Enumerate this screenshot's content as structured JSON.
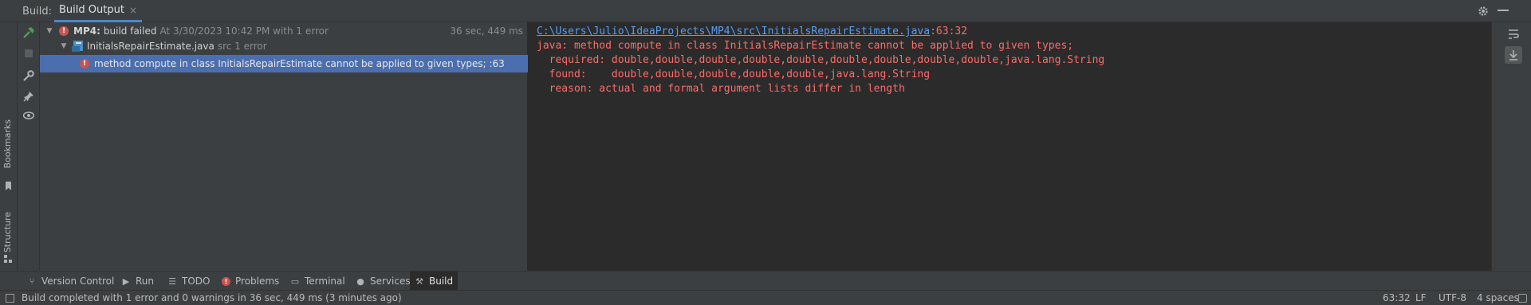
{
  "header": {
    "build_label": "Build:",
    "tab_label": "Build Output",
    "tab_close": "×"
  },
  "left_stripe": {
    "bookmarks": "Bookmarks",
    "structure": "Structure"
  },
  "tree": {
    "root": {
      "project": "MP4:",
      "status": "build failed",
      "detail": "At 3/30/2023 10:42 PM with 1 error",
      "time": "36 sec, 449 ms"
    },
    "file": {
      "name": "InitialsRepairEstimate.java",
      "detail": "src 1 error"
    },
    "error": {
      "message": "method compute in class InitialsRepairEstimate cannot be applied to given types; :63"
    }
  },
  "console": {
    "path": "C:\\Users\\Julio\\IdeaProjects\\MP4\\src\\InitialsRepairEstimate.java",
    "position": ":63:32",
    "line1": "java: method compute in class InitialsRepairEstimate cannot be applied to given types;",
    "line2": "  required: double,double,double,double,double,double,double,double,double,java.lang.String",
    "line3": "  found:    double,double,double,double,double,java.lang.String",
    "line4": "  reason: actual and formal argument lists differ in length"
  },
  "bottom_tabs": [
    {
      "label": "Version Control",
      "icon": "branch-icon"
    },
    {
      "label": "Run",
      "icon": "play-icon"
    },
    {
      "label": "TODO",
      "icon": "list-icon"
    },
    {
      "label": "Problems",
      "icon": "error-icon"
    },
    {
      "label": "Terminal",
      "icon": "terminal-icon"
    },
    {
      "label": "Services",
      "icon": "services-icon"
    },
    {
      "label": "Build",
      "icon": "hammer-icon"
    }
  ],
  "status_bar": {
    "message": "Build completed with 1 error and 0 warnings in 36 sec, 449 ms (3 minutes ago)",
    "position": "63:32",
    "line_separator": "LF",
    "encoding": "UTF-8",
    "indent": "4 spaces"
  },
  "colors": {
    "error": "#c75450",
    "console_error_text": "#ff6b68",
    "link": "#589df6",
    "selection": "#4b6eaf",
    "success_hammer": "#499c54"
  }
}
